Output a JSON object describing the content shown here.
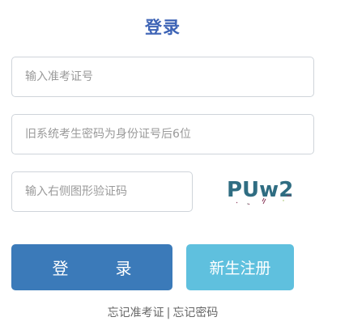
{
  "title": "登录",
  "fields": {
    "exam_number": {
      "placeholder": "输入准考证号",
      "value": ""
    },
    "password": {
      "placeholder": "旧系统考生密码为身份证号后6位",
      "value": ""
    },
    "captcha": {
      "placeholder": "输入右侧图形验证码",
      "value": ""
    }
  },
  "captcha_image": {
    "text": "PUw2",
    "color": "#2f6d82"
  },
  "buttons": {
    "login": "登录",
    "register": "新生注册"
  },
  "links": {
    "forgot_exam_number": "忘记准考证",
    "separator": "|",
    "forgot_password": "忘记密码"
  },
  "colors": {
    "title": "#3e64b6",
    "login_button": "#3b7ab9",
    "register_button": "#5fc0de"
  }
}
